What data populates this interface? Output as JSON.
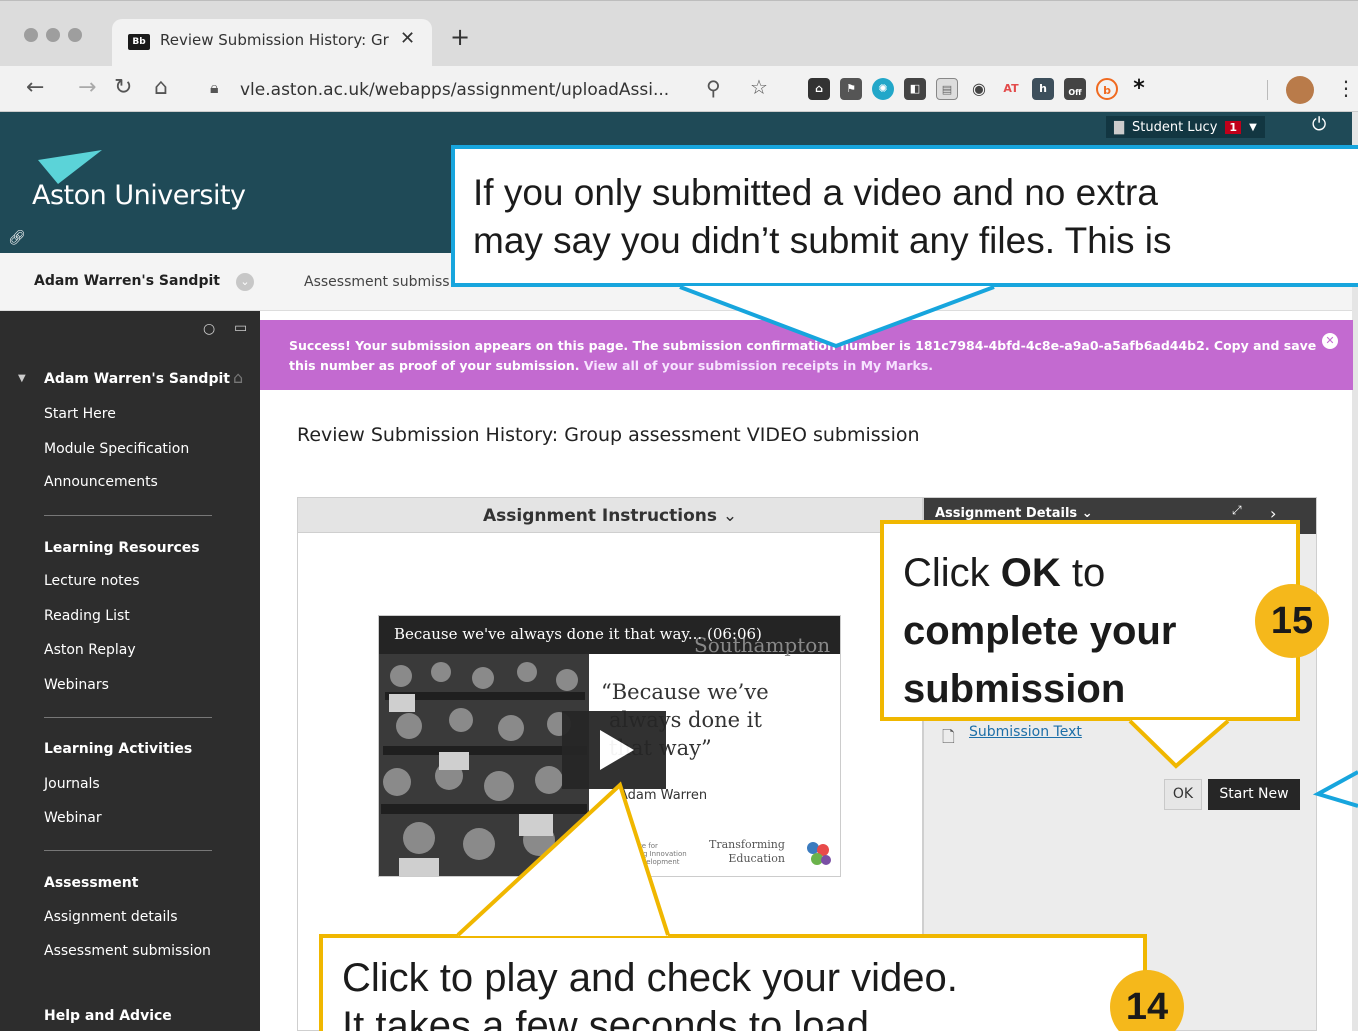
{
  "browser": {
    "tab_favicon": "Bb",
    "tab_title": "Review Submission History: Gr",
    "tab_close": "✕",
    "new_tab": "+",
    "url": "vle.aston.ac.uk/webapps/assignment/uploadAssi...",
    "ext_at_label": "AT",
    "ext_off_label": "Off"
  },
  "header": {
    "logo_text": "Aston University",
    "user_name": "Student Lucy",
    "notification_count": "1"
  },
  "course_bar": {
    "course_name": "Adam Warren's Sandpit",
    "breadcrumb": "Assessment submiss"
  },
  "sidebar": {
    "root": "Adam Warren's Sandpit",
    "items": [
      "Start Here",
      "Module Specification",
      "Announcements",
      "Learning Resources",
      "Lecture notes",
      "Reading List",
      "Aston Replay",
      "Webinars",
      "Learning Activities",
      "Journals",
      "Webinar",
      "Assessment",
      "Assignment details",
      "Assessment submission",
      "Help and Advice"
    ]
  },
  "success": {
    "message": "Success! Your submission appears on this page. The submission confirmation number is 181c7984-4bfd-4c8e-a9a0-a5afb6ad44b2. Copy and save this number as proof of your submission.",
    "link": "View all of your submission receipts in My Marks."
  },
  "main": {
    "page_title": "Review Submission History: Group assessment VIDEO submission",
    "instructions_title": "Assignment Instructions",
    "details_title": "Assignment Details",
    "submission_link": "Submission Text",
    "ok_label": "OK",
    "start_new_label": "Start New"
  },
  "video": {
    "title": "Because we've always done it that way... (06:06)",
    "university": "Southampton",
    "quote_line1": "“Because we’ve",
    "quote_line2": "always done it",
    "quote_line3": "that way”",
    "author": "Adam Warren",
    "institute_line1": "Institute for",
    "institute_line2": "Learning Innovation",
    "institute_line3": "and Development",
    "transforming": "Transforming",
    "education": "Education"
  },
  "callouts": {
    "blue_line1": "If you only submitted a video and no extra",
    "blue_line2": "may say you didn’t submit any files. This is",
    "c15_line1_pre": "Click ",
    "c15_line1_bold": "OK",
    "c15_line1_post": " to",
    "c15_line2": "complete your",
    "c15_line3": "submission",
    "c15_badge": "15",
    "c14_line1": "Click to play and check your video.",
    "c14_line2": "It takes a few seconds to load.",
    "c14_badge": "14"
  },
  "colors": {
    "header": "#1f4a57",
    "success": "#c36ad0",
    "callout_blue": "#17a5dd",
    "callout_gold": "#f0b700",
    "badge": "#f5b81b"
  }
}
